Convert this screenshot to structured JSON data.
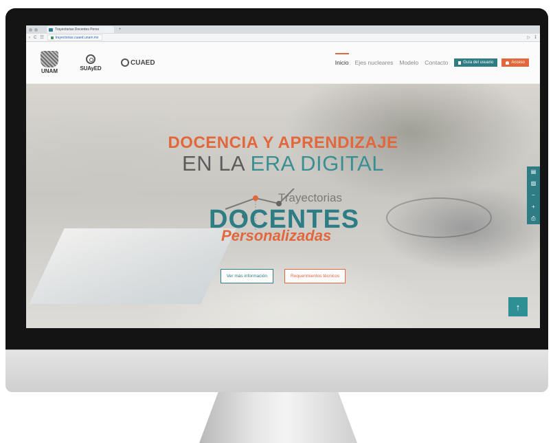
{
  "browser": {
    "tab_title": "Trayectorias Docentes Perso",
    "new_tab": "+",
    "url": "trayectorias.cuaed.unam.mx",
    "nav_back": "‹",
    "nav_reload": "C",
    "nav_grid": "☷"
  },
  "header": {
    "logo_unam": "UNAM",
    "logo_suayed": "SUAyED",
    "logo_cuaed": "CUAED",
    "nav": {
      "inicio": "Inicio",
      "ejes": "Ejes nucleares",
      "modelo": "Modelo",
      "contacto": "Contacto"
    },
    "btn_guide": "Guía del usuario",
    "btn_access": "Acceso"
  },
  "hero": {
    "line1": "DOCENCIA Y APRENDIZAJE",
    "line2_a": "EN LA ",
    "line2_b": "ERA DIGITAL",
    "logo_trayectorias": "Trayectorias",
    "logo_docentes": "DOCENTES",
    "logo_personalizadas": "Personalizadas",
    "btn_info": "Ver más información",
    "btn_req": "Requerimientos técnicos"
  },
  "tools": {
    "t1": "▤",
    "t2": "▨",
    "t3": "−",
    "t4": "+",
    "t5": "⎙"
  },
  "back_to_top": "↑",
  "colors": {
    "teal": "#2e7d84",
    "orange": "#e2673c"
  }
}
